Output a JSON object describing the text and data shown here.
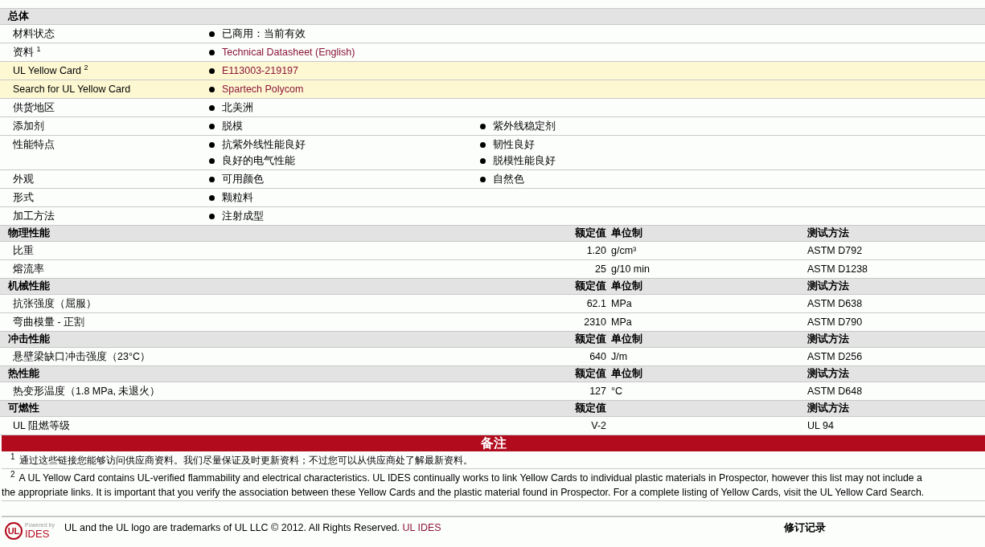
{
  "general": {
    "title": "总体",
    "rows": [
      {
        "label": "材料状态",
        "highlighted": false,
        "columns": [
          [
            {
              "text": "已商用：当前有效",
              "link": false
            }
          ]
        ]
      },
      {
        "label": "资料 $^{1}$",
        "highlighted": false,
        "columns": [
          [
            {
              "text": "Technical Datasheet (English)",
              "link": true
            }
          ]
        ]
      },
      {
        "label": "UL Yellow Card $^{2}$",
        "highlighted": true,
        "columns": [
          [
            {
              "text": "E113003-219197",
              "link": true
            }
          ]
        ]
      },
      {
        "label": "Search for UL Yellow Card",
        "highlighted": true,
        "columns": [
          [
            {
              "text": "Spartech Polycom",
              "link": true
            }
          ]
        ]
      },
      {
        "label": "供货地区",
        "highlighted": false,
        "columns": [
          [
            {
              "text": "北美洲",
              "link": false
            }
          ]
        ]
      },
      {
        "label": "添加剂",
        "highlighted": false,
        "columns": [
          [
            {
              "text": "脱模",
              "link": false
            }
          ],
          [
            {
              "text": "紫外线稳定剂",
              "link": false
            }
          ]
        ]
      },
      {
        "label": "性能特点",
        "highlighted": false,
        "columns": [
          [
            {
              "text": "抗紫外线性能良好",
              "link": false
            },
            {
              "text": "良好的电气性能",
              "link": false
            }
          ],
          [
            {
              "text": "韧性良好",
              "link": false
            },
            {
              "text": "脱模性能良好",
              "link": false
            }
          ]
        ]
      },
      {
        "label": "外观",
        "highlighted": false,
        "columns": [
          [
            {
              "text": "可用颜色",
              "link": false
            }
          ],
          [
            {
              "text": "自然色",
              "link": false
            }
          ]
        ]
      },
      {
        "label": "形式",
        "highlighted": false,
        "columns": [
          [
            {
              "text": "颗粒料",
              "link": false
            }
          ]
        ]
      },
      {
        "label": "加工方法",
        "highlighted": false,
        "columns": [
          [
            {
              "text": "注射成型",
              "link": false
            }
          ]
        ]
      }
    ]
  },
  "sections": [
    {
      "title": "物理性能",
      "value_heading": "额定值",
      "unit_heading": "单位制",
      "method_heading": "测试方法",
      "rows": [
        {
          "property": "比重",
          "value": "1.20",
          "unit": "g/cm³",
          "method": "ASTM D792"
        },
        {
          "property": "熔流率",
          "value": "25",
          "unit": "g/10 min",
          "method": "ASTM D1238"
        }
      ]
    },
    {
      "title": "机械性能",
      "value_heading": "额定值",
      "unit_heading": "单位制",
      "method_heading": "测试方法",
      "rows": [
        {
          "property": "抗张强度（屈服）",
          "value": "62.1",
          "unit": "MPa",
          "method": "ASTM D638"
        },
        {
          "property": "弯曲模量 - 正割",
          "value": "2310",
          "unit": "MPa",
          "method": "ASTM D790"
        }
      ]
    },
    {
      "title": "冲击性能",
      "value_heading": "额定值",
      "unit_heading": "单位制",
      "method_heading": "测试方法",
      "rows": [
        {
          "property": "悬壁梁缺口冲击强度（23°C）",
          "value": "640",
          "unit": "J/m",
          "method": "ASTM D256"
        }
      ]
    },
    {
      "title": "热性能",
      "value_heading": "额定值",
      "unit_heading": "单位制",
      "method_heading": "测试方法",
      "rows": [
        {
          "property": "热变形温度（1.8 MPa, 未退火）",
          "value": "127",
          "unit": "°C",
          "method": "ASTM D648"
        }
      ]
    },
    {
      "title": "可燃性",
      "value_heading": "额定值",
      "method_heading": "测试方法",
      "rows": [
        {
          "property": "UL 阻燃等级",
          "value": "V-2",
          "method": "UL 94"
        }
      ]
    }
  ],
  "notes": {
    "title": "备注",
    "items": [
      {
        "mark": "1",
        "lines": [
          "通过这些链接您能够访问供应商资料。我们尽量保证及时更新资料；不过您可以从供应商处了解最新资料。"
        ]
      },
      {
        "mark": "2",
        "lines": [
          "A UL Yellow Card contains UL-verified flammability and electrical characteristics. UL IDES continually works to link Yellow Cards to individual plastic materials in Prospector, however this list may not include a",
          "the appropriate links. It is important that you verify the association between these Yellow Cards and the plastic material found in Prospector. For a complete listing of Yellow Cards, visit the UL Yellow Card Search."
        ]
      }
    ]
  },
  "footer": {
    "logo": {
      "mark": "UL",
      "caption": "Powered by",
      "brand": "IDES"
    },
    "trademark": "UL and the UL logo are trademarks of UL LLC © 2012. All Rights Reserved.",
    "link": "UL IDES",
    "revision_title": "修订记录"
  }
}
